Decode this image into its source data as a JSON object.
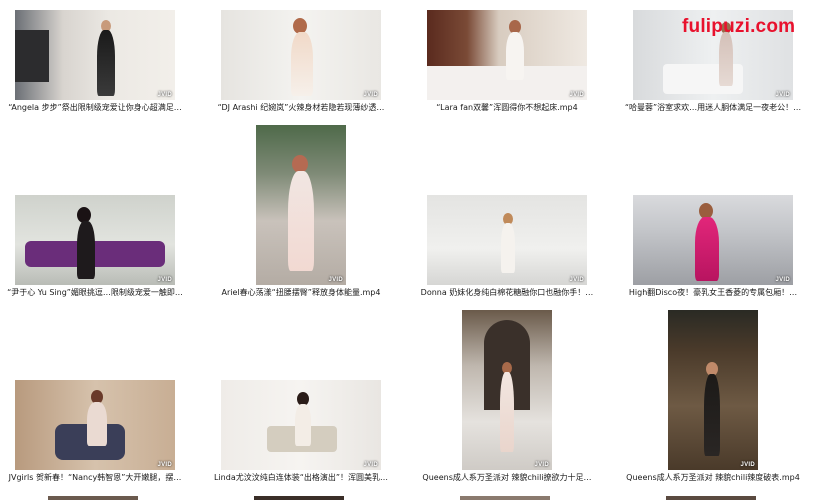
{
  "watermark": "fulipuzi.com",
  "badge_text": "JVID",
  "files": [
    {
      "caption": "“Angela 步步”祭出限制级宠爱让你身心超满足…"
    },
    {
      "caption": "“DJ Arashi 纪婉岚”火辣身材若隐若现薄纱透…"
    },
    {
      "caption": "“Lara fan双馨”浑圆得你不想起床.mp4"
    },
    {
      "caption": "“哈曼蓉”浴室求欢…用迷人胴体满足一夜老公！…"
    },
    {
      "caption": "“尹于心 Yu Sing”媚眼挑逗…限制级宠爱一触即…"
    },
    {
      "caption": "Ariel春心荡漾“扭腰摆臀”释放身体能量.mp4"
    },
    {
      "caption": "Donna 奶妹化身纯白棉花糖融你口也融你手！…"
    },
    {
      "caption": "High翻Disco夜！豪乳女王香菱的专属包厢！…"
    },
    {
      "caption": "JVgirls 贺新春！“Nancy韩智恩”大开嫩腿，摆…"
    },
    {
      "caption": "Linda尤汶汶纯白连体装“出格演出”！浑圆美乳…"
    },
    {
      "caption": "Queens成人系万圣派对 辣貌chili撩欲力十足…"
    },
    {
      "caption": "Queens成人系万圣派对 辣貌chili辣度破表.mp4"
    }
  ]
}
